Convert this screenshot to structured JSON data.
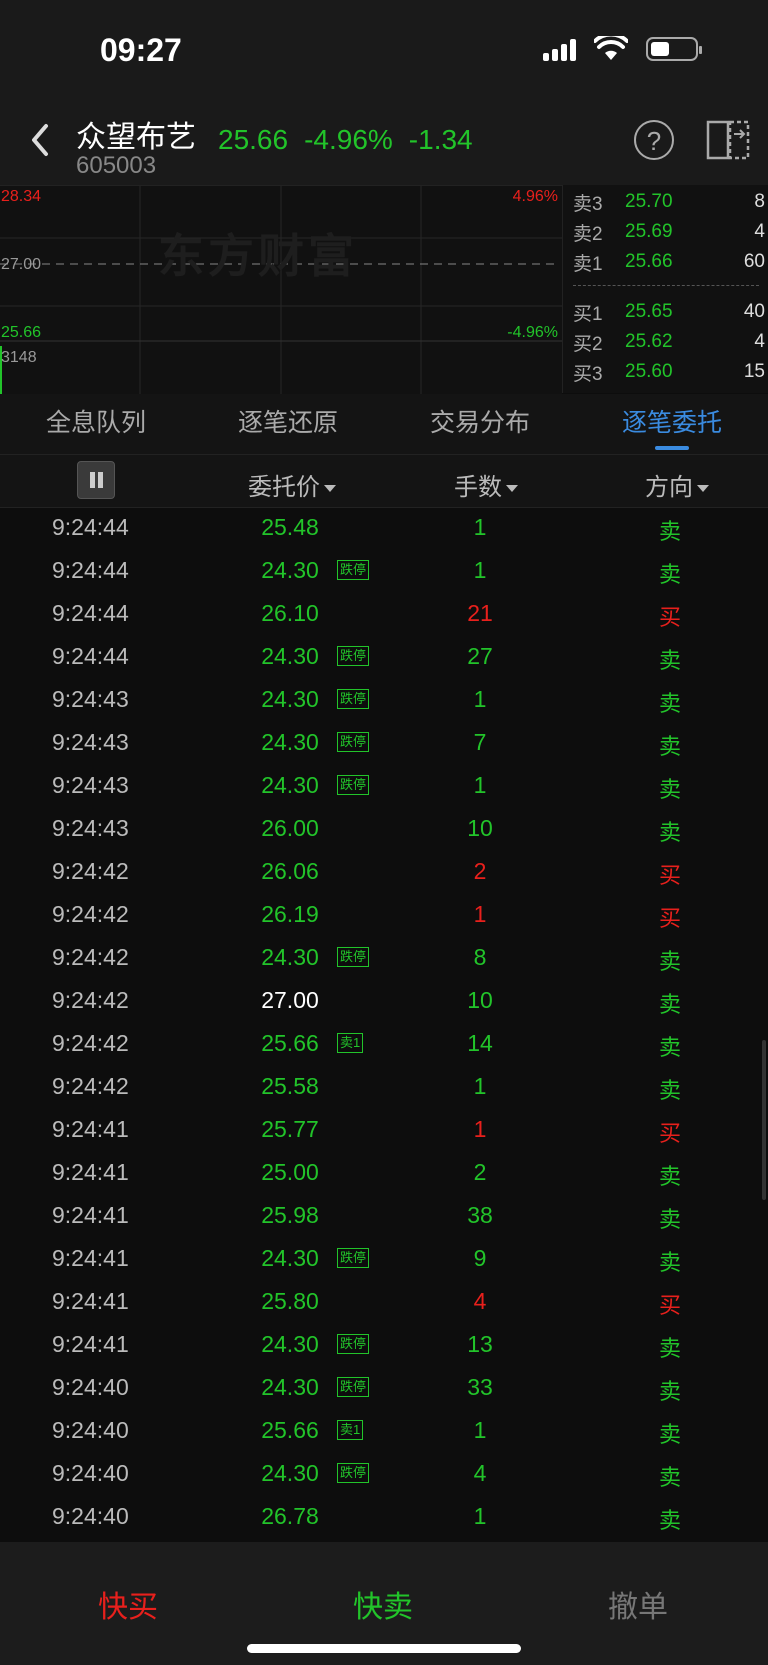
{
  "status": {
    "time": "09:27"
  },
  "header": {
    "name": "众望布艺",
    "code": "605003",
    "price": "25.66",
    "change_pct": "-4.96%",
    "change": "-1.34",
    "help_icon": "?"
  },
  "chart": {
    "upper_price": "28.34",
    "upper_pct": "4.96%",
    "base_price": "27.00",
    "lower_price": "25.66",
    "lower_pct": "-4.96%",
    "volume": "3148",
    "watermark": "东方财富"
  },
  "orderbook": {
    "sell": [
      {
        "label": "卖3",
        "price": "25.70",
        "vol": "8"
      },
      {
        "label": "卖2",
        "price": "25.69",
        "vol": "4"
      },
      {
        "label": "卖1",
        "price": "25.66",
        "vol": "60"
      }
    ],
    "buy": [
      {
        "label": "买1",
        "price": "25.65",
        "vol": "40"
      },
      {
        "label": "买2",
        "price": "25.62",
        "vol": "4"
      },
      {
        "label": "买3",
        "price": "25.60",
        "vol": "15"
      }
    ]
  },
  "tabs": [
    {
      "label": "全息队列"
    },
    {
      "label": "逐笔还原"
    },
    {
      "label": "交易分布"
    },
    {
      "label": "逐笔委托"
    }
  ],
  "columns": {
    "price": "委托价",
    "volume": "手数",
    "direction": "方向"
  },
  "rows": [
    {
      "time": "9:24:44",
      "price": "25.48",
      "tag": "",
      "vol": "1",
      "dir": "卖"
    },
    {
      "time": "9:24:44",
      "price": "24.30",
      "tag": "跌停",
      "vol": "1",
      "dir": "卖"
    },
    {
      "time": "9:24:44",
      "price": "26.10",
      "tag": "",
      "vol": "21",
      "dir": "买"
    },
    {
      "time": "9:24:44",
      "price": "24.30",
      "tag": "跌停",
      "vol": "27",
      "dir": "卖"
    },
    {
      "time": "9:24:43",
      "price": "24.30",
      "tag": "跌停",
      "vol": "1",
      "dir": "卖"
    },
    {
      "time": "9:24:43",
      "price": "24.30",
      "tag": "跌停",
      "vol": "7",
      "dir": "卖"
    },
    {
      "time": "9:24:43",
      "price": "24.30",
      "tag": "跌停",
      "vol": "1",
      "dir": "卖"
    },
    {
      "time": "9:24:43",
      "price": "26.00",
      "tag": "",
      "vol": "10",
      "dir": "卖"
    },
    {
      "time": "9:24:42",
      "price": "26.06",
      "tag": "",
      "vol": "2",
      "dir": "买"
    },
    {
      "time": "9:24:42",
      "price": "26.19",
      "tag": "",
      "vol": "1",
      "dir": "买"
    },
    {
      "time": "9:24:42",
      "price": "24.30",
      "tag": "跌停",
      "vol": "8",
      "dir": "卖"
    },
    {
      "time": "9:24:42",
      "price": "27.00",
      "tag": "",
      "vol": "10",
      "dir": "卖"
    },
    {
      "time": "9:24:42",
      "price": "25.66",
      "tag": "卖1",
      "vol": "14",
      "dir": "卖"
    },
    {
      "time": "9:24:42",
      "price": "25.58",
      "tag": "",
      "vol": "1",
      "dir": "卖"
    },
    {
      "time": "9:24:41",
      "price": "25.77",
      "tag": "",
      "vol": "1",
      "dir": "买"
    },
    {
      "time": "9:24:41",
      "price": "25.00",
      "tag": "",
      "vol": "2",
      "dir": "卖"
    },
    {
      "time": "9:24:41",
      "price": "25.98",
      "tag": "",
      "vol": "38",
      "dir": "卖"
    },
    {
      "time": "9:24:41",
      "price": "24.30",
      "tag": "跌停",
      "vol": "9",
      "dir": "卖"
    },
    {
      "time": "9:24:41",
      "price": "25.80",
      "tag": "",
      "vol": "4",
      "dir": "买"
    },
    {
      "time": "9:24:41",
      "price": "24.30",
      "tag": "跌停",
      "vol": "13",
      "dir": "卖"
    },
    {
      "time": "9:24:40",
      "price": "24.30",
      "tag": "跌停",
      "vol": "33",
      "dir": "卖"
    },
    {
      "time": "9:24:40",
      "price": "25.66",
      "tag": "卖1",
      "vol": "1",
      "dir": "卖"
    },
    {
      "time": "9:24:40",
      "price": "24.30",
      "tag": "跌停",
      "vol": "4",
      "dir": "卖"
    },
    {
      "time": "9:24:40",
      "price": "26.78",
      "tag": "",
      "vol": "1",
      "dir": "卖"
    }
  ],
  "bottom": {
    "quick_buy": "快买",
    "quick_sell": "快卖",
    "cancel": "撤单"
  },
  "colors": {
    "up": "#e8201c",
    "down": "#22c42a",
    "neutral": "#ffffff",
    "accent": "#3a8be0"
  }
}
